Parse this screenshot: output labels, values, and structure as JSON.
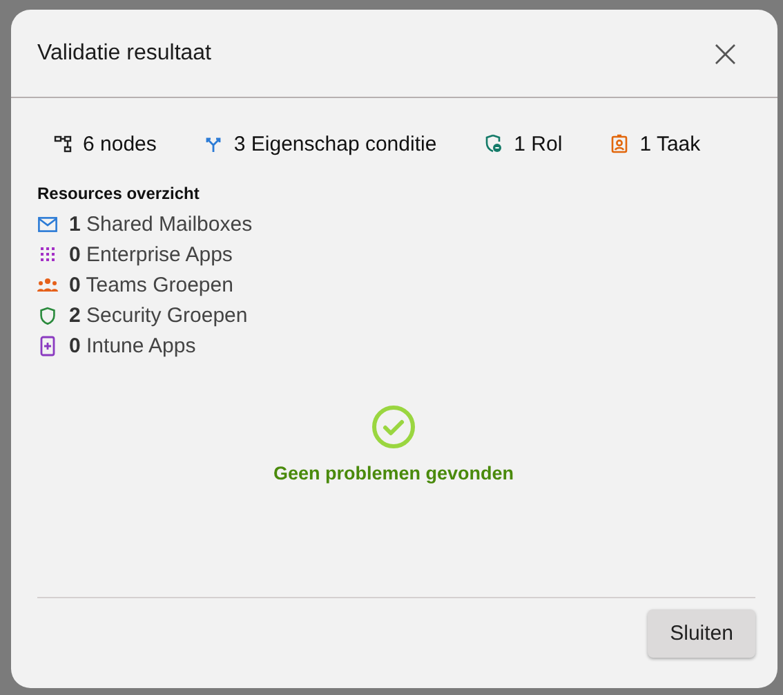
{
  "dialog": {
    "title": "Validatie resultaat",
    "close": "×"
  },
  "stats": [
    {
      "kind": "nodes",
      "text": "6 nodes"
    },
    {
      "kind": "condition",
      "text": "3 Eigenschap conditie"
    },
    {
      "kind": "role",
      "text": "1 Rol"
    },
    {
      "kind": "task",
      "text": "1 Taak"
    }
  ],
  "resources": {
    "heading": "Resources overzicht",
    "items": [
      {
        "kind": "mail",
        "count": "1",
        "label": "Shared Mailboxes"
      },
      {
        "kind": "apps",
        "count": "0",
        "label": "Enterprise Apps"
      },
      {
        "kind": "teams",
        "count": "0",
        "label": "Teams Groepen"
      },
      {
        "kind": "security",
        "count": "2",
        "label": "Security Groepen"
      },
      {
        "kind": "intune",
        "count": "0",
        "label": "Intune Apps"
      }
    ]
  },
  "result": {
    "message": "Geen problemen gevonden"
  },
  "buttons": [
    "Sluiten"
  ]
}
